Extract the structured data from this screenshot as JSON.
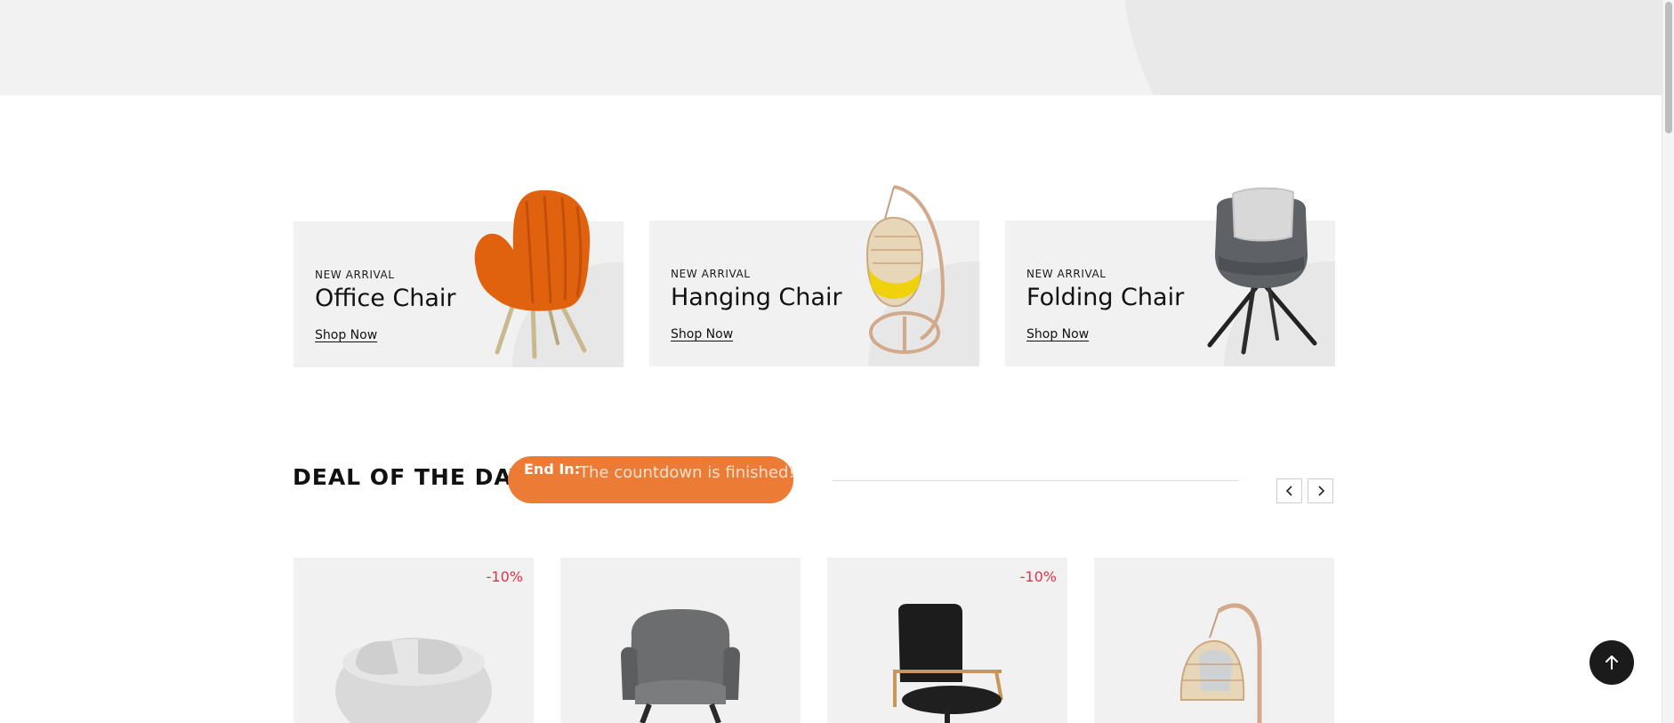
{
  "banners": [
    {
      "kicker": "NEW ARRIVAL",
      "title": "Office Chair",
      "link": "Shop Now"
    },
    {
      "kicker": "NEW ARRIVAL",
      "title": "Hanging Chair",
      "link": "Shop Now"
    },
    {
      "kicker": "NEW ARRIVAL",
      "title": "Folding Chair",
      "link": "Shop Now"
    }
  ],
  "deal": {
    "title": "DEAL OF THE DAY",
    "end_label": "End In:",
    "countdown_message": "The countdown is finished!"
  },
  "products": [
    {
      "discount": "-10%"
    },
    {
      "discount": ""
    },
    {
      "discount": "-10%"
    },
    {
      "discount": ""
    }
  ],
  "colors": {
    "accent": "#ec7b36",
    "discount": "#e0324f",
    "card_bg": "#f1f1f1"
  },
  "icons": {
    "prev": "chevron-left-icon",
    "next": "chevron-right-icon",
    "back_to_top": "arrow-up-icon"
  }
}
